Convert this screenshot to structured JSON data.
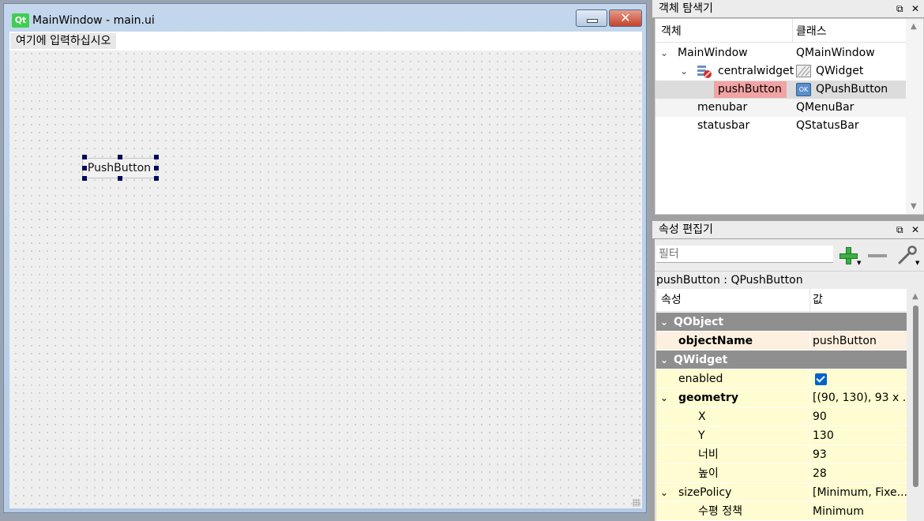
{
  "form_window": {
    "title": "MainWindow - main.ui",
    "logo_text": "Qt",
    "menu_placeholder": "여기에 입력하십시오",
    "push_button_text": "PushButton",
    "close_glyph": "✕"
  },
  "object_inspector": {
    "title": "객체 탐색기",
    "float_icon": "⧉",
    "close_icon": "✕",
    "headers": {
      "object": "객체",
      "class": "클래스"
    },
    "rows": [
      {
        "name": "MainWindow",
        "class": "QMainWindow",
        "icon": "none",
        "class_icon": "none"
      },
      {
        "name": "centralwidget",
        "class": "QWidget",
        "icon": "broken-layout-icon",
        "class_icon": "widget-hatched-icon"
      },
      {
        "name": "pushButton",
        "class": "QPushButton",
        "icon": "none",
        "class_icon": "ok-button-icon"
      },
      {
        "name": "menubar",
        "class": "QMenuBar",
        "icon": "none",
        "class_icon": "none"
      },
      {
        "name": "statusbar",
        "class": "QStatusBar",
        "icon": "none",
        "class_icon": "none"
      }
    ],
    "ok_icon_text": "OK",
    "selected_highlight_color": "#f2a3a3"
  },
  "property_editor": {
    "title": "속성 편집기",
    "float_icon": "⧉",
    "close_icon": "✕",
    "filter_placeholder": "필터",
    "context_label": "pushButton : QPushButton",
    "headers": {
      "property": "속성",
      "value": "값"
    },
    "group_qobject": "QObject",
    "group_qwidget": "QWidget",
    "rows": {
      "objectName": {
        "name": "objectName",
        "value": "pushButton"
      },
      "enabled": {
        "name": "enabled",
        "checked": true
      },
      "geometry": {
        "name": "geometry",
        "value": "[(90, 130), 93 x ..."
      },
      "x": {
        "name": "X",
        "value": "90"
      },
      "y": {
        "name": "Y",
        "value": "130"
      },
      "width": {
        "name": "너비",
        "value": "93"
      },
      "height": {
        "name": "높이",
        "value": "28"
      },
      "sizePolicy": {
        "name": "sizePolicy",
        "value": "[Minimum, Fixe..."
      },
      "hpolicy": {
        "name": "수평 정책",
        "value": "Minimum"
      }
    },
    "colors": {
      "group_bg": "#8f8f8f",
      "qobject_row_bg": "#fdf0e0",
      "qwidget_row_bg": "#fefcd0"
    }
  }
}
